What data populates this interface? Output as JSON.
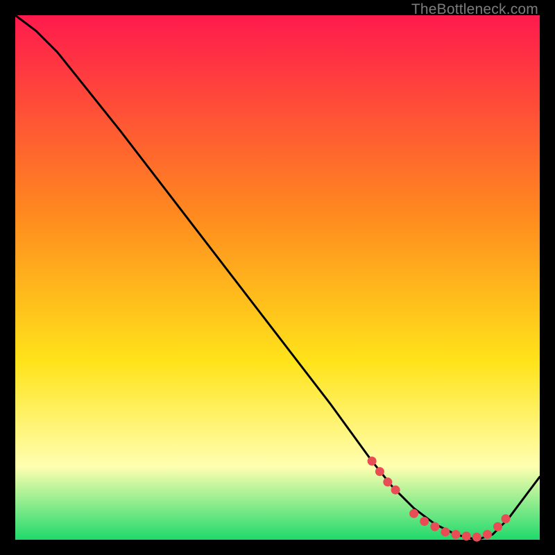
{
  "watermark": "TheBottleneck.com",
  "chart_data": {
    "type": "line",
    "title": "",
    "xlabel": "",
    "ylabel": "",
    "xlim": [
      0,
      100
    ],
    "ylim": [
      0,
      100
    ],
    "grid": false,
    "legend": false,
    "series": [
      {
        "name": "bottleneck-curve",
        "color": "#000000",
        "x": [
          0,
          4,
          8,
          12,
          20,
          30,
          40,
          50,
          60,
          68,
          72,
          76,
          80,
          84,
          88,
          91,
          94,
          100
        ],
        "y": [
          100,
          97,
          93,
          88,
          78,
          65,
          52,
          39,
          26,
          15,
          10,
          6,
          3,
          1,
          0,
          1,
          4,
          12
        ]
      }
    ],
    "marker_series": {
      "name": "highlight-dots",
      "color": "#e84d55",
      "x": [
        68,
        69.5,
        71,
        72.5,
        76,
        78,
        80,
        82,
        84,
        86,
        88,
        90,
        92,
        93.5
      ],
      "y": [
        15,
        13,
        11,
        9.5,
        5,
        3.5,
        2.5,
        1.5,
        1,
        0.7,
        0.5,
        1,
        2.5,
        4
      ]
    },
    "background_gradient": {
      "top": "#ff1a4d",
      "mid1": "#ff8a1f",
      "mid2": "#ffe31a",
      "pale": "#ffffb0",
      "bottom": "#1fd96b"
    }
  }
}
